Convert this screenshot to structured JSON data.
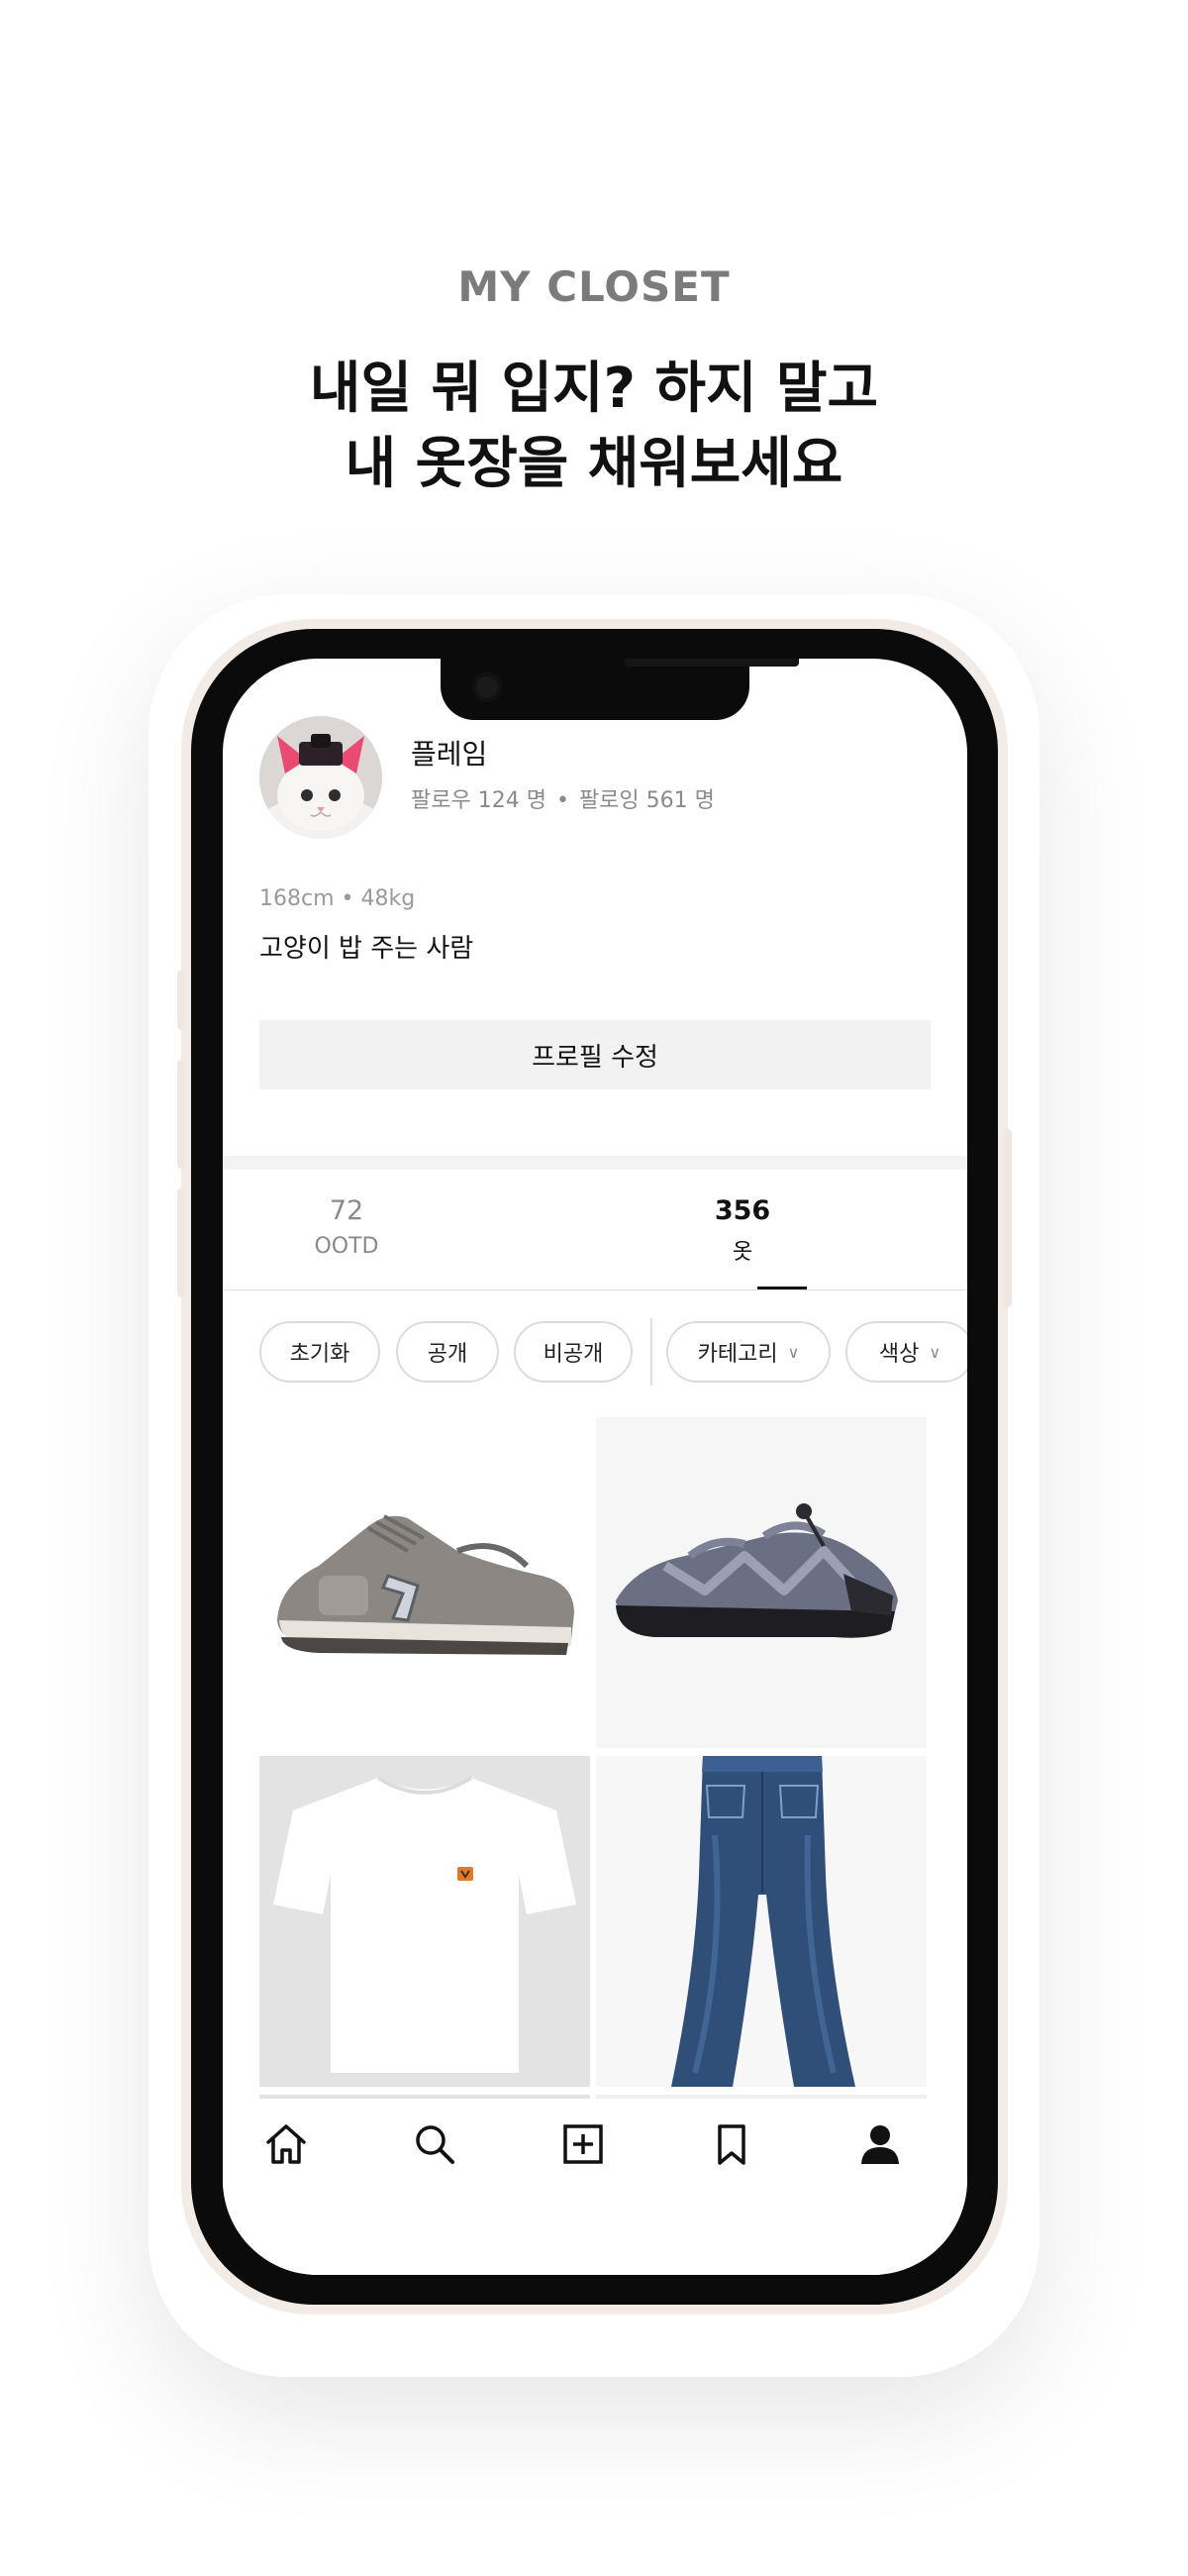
{
  "promo": {
    "eyebrow": "MY CLOSET",
    "title_line1": "내일 뭐 입지? 하지 말고",
    "title_line2": "내 옷장을 채워보세요"
  },
  "profile": {
    "nickname": "플레임",
    "followers": "팔로우 124 명",
    "following": "팔로잉 561 명",
    "separator": "•",
    "body_info": "168cm • 48kg",
    "bio": "고양이 밥 주는 사람",
    "edit_button": "프로필 수정"
  },
  "tabs": [
    {
      "count": "72",
      "label": "OOTD",
      "active": false
    },
    {
      "count": "356",
      "label": "옷",
      "active": true
    }
  ],
  "filters": {
    "reset": "초기화",
    "public": "공개",
    "private": "비공개",
    "category": "카테고리",
    "color": "색상",
    "chevron": "∨"
  },
  "grid_items": [
    {
      "name": "grey-running-sneaker",
      "background": "#ffffff"
    },
    {
      "name": "grey-strap-sandal",
      "background": "#f6f6f6"
    },
    {
      "name": "white-tshirt",
      "background": "#e3e3e3"
    },
    {
      "name": "blue-flare-jeans",
      "background": "#f7f7f7"
    }
  ],
  "bottom_nav": [
    "home-icon",
    "search-icon",
    "add-icon",
    "bookmark-icon",
    "profile-icon"
  ]
}
